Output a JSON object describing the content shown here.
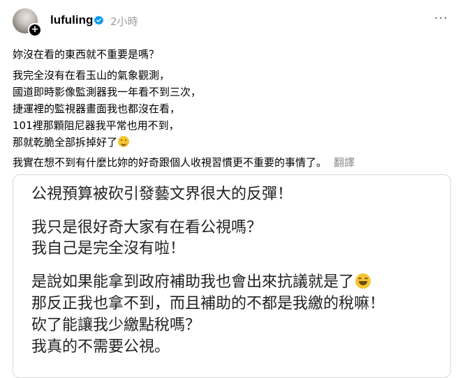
{
  "post": {
    "username": "lufuling",
    "timestamp": "2小時",
    "more": "···",
    "avatar_icon": "avatar-plus-icon",
    "verified_icon": "verified-badge-icon",
    "verified_color": "#0095f6",
    "paragraph1": "妳沒在看的東西就不重要是嗎？",
    "paragraph2_lines": [
      "我完全沒有在看玉山的氣象觀測，",
      "國道即時影像監測器我一年看不到三次，",
      "捷運裡的監視器畫面我也都沒在看，",
      "101裡那顆阻尼器我平常也用不到，",
      "那就乾脆全部拆掉好了"
    ],
    "paragraph3": "我實在想不到有什麼比妳的好奇跟個人收視習慣更不重要的事情了。",
    "translate_label": "翻譯"
  },
  "card": {
    "lines": [
      "公視預算被砍引發藝文界很大的反彈！",
      "我只是很好奇大家有在看公視嗎？",
      "我自己是完全沒有啦！",
      "是說如果能拿到政府補助我也會出來抗議就是了",
      "那反正我也拿不到，而且補助的不都是我繳的稅嘛！",
      "砍了能讓我少繳點稅嗎？",
      "我真的不需要公視。"
    ]
  }
}
